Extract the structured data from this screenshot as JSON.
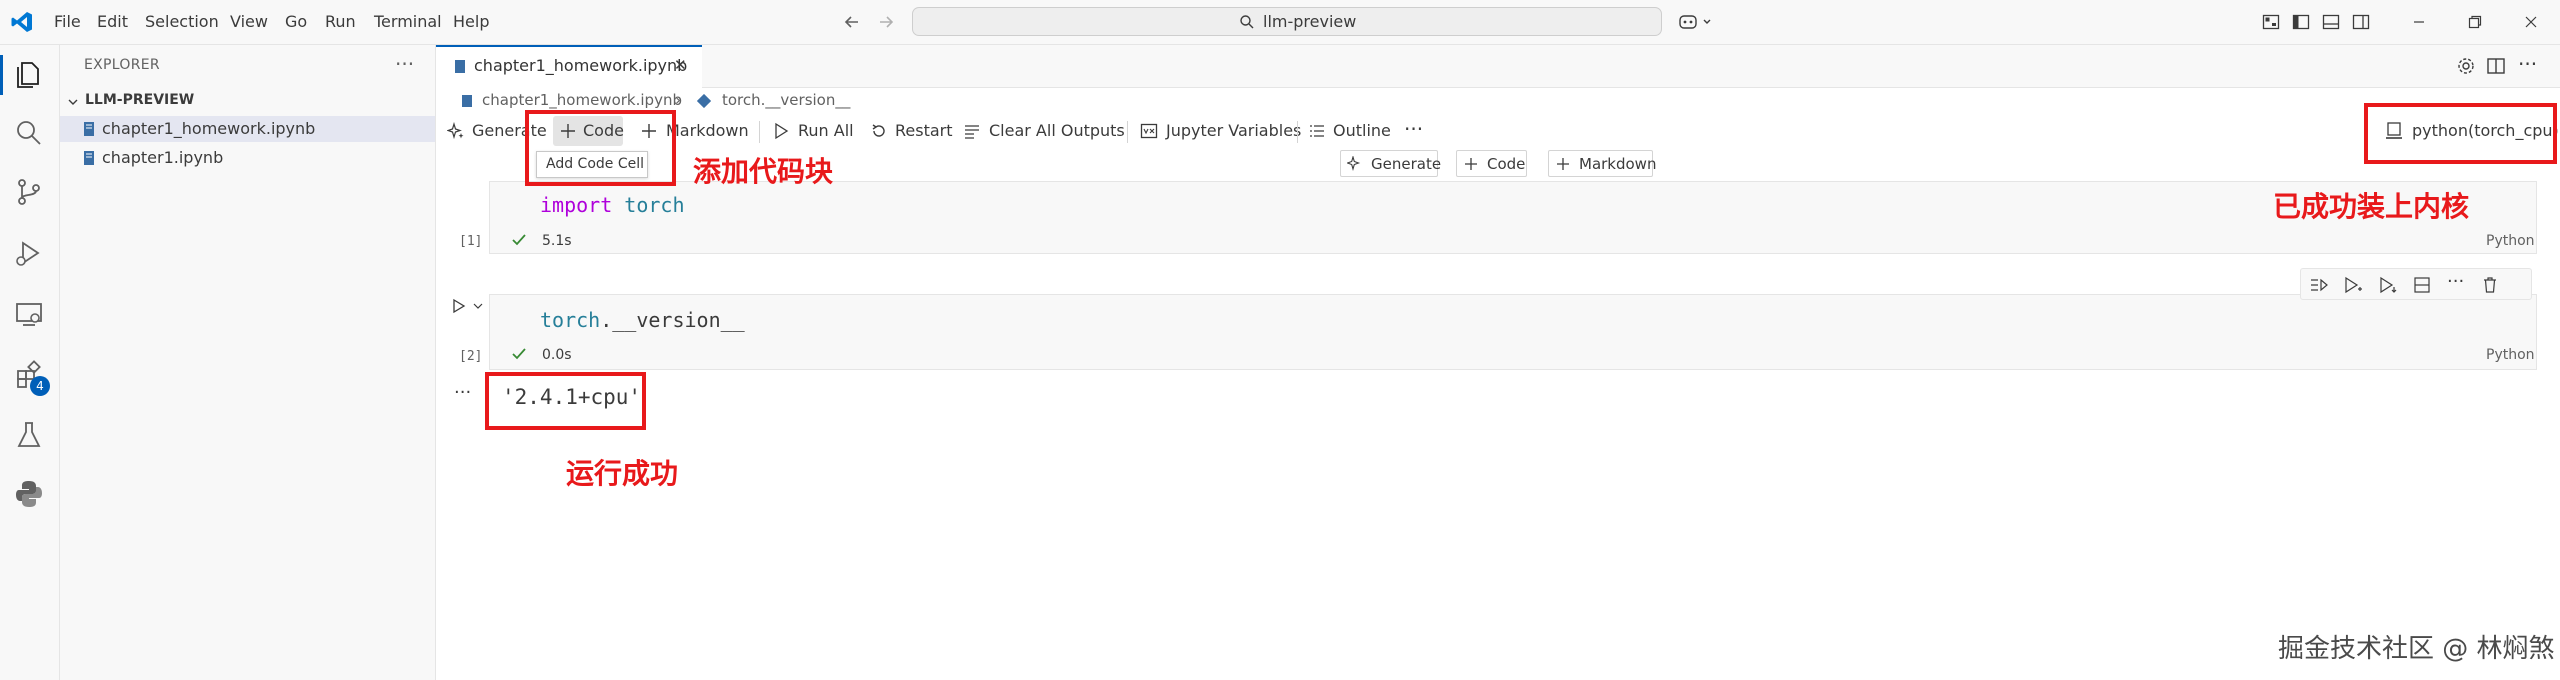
{
  "menu": [
    "File",
    "Edit",
    "Selection",
    "View",
    "Go",
    "Run",
    "Terminal",
    "Help"
  ],
  "search": {
    "text": "llm-preview"
  },
  "sidebar": {
    "title": "EXPLORER",
    "more": "···",
    "section": "LLM-PREVIEW",
    "files": [
      "chapter1_homework.ipynb",
      "chapter1.ipynb"
    ]
  },
  "activity": {
    "extensions_badge": "4"
  },
  "tab": {
    "label": "chapter1_homework.ipynb",
    "close": "✕"
  },
  "breadcrumb": {
    "file": "chapter1_homework.ipynb",
    "symbol": "torch.__version__"
  },
  "toolbar": {
    "generate": "Generate",
    "code": "Code",
    "markdown": "Markdown",
    "run_all": "Run All",
    "restart": "Restart",
    "clear_outputs": "Clear All Outputs",
    "jupyter_variables": "Jupyter Variables",
    "outline": "Outline",
    "more": "···"
  },
  "tooltip": "Add Code Cell",
  "between_cells": {
    "generate": "Generate",
    "code": "Code",
    "markdown": "Markdown"
  },
  "kernel": "python(torch_cpu)",
  "cells": [
    {
      "count": "[1]",
      "code_kw": "import",
      "code_id": "torch",
      "time": "5.1s",
      "lang": "Python"
    },
    {
      "count": "[2]",
      "code_id": "torch",
      "code_rest": ".__version__",
      "time": "0.0s",
      "lang": "Python",
      "output": "'2.4.1+cpu'"
    }
  ],
  "output_more": "···",
  "annotations": {
    "add_code": "添加代码块",
    "kernel_ok": "已成功装上内核",
    "run_ok": "运行成功"
  },
  "watermark": "掘金技术社区 @ 林焖煞",
  "colors": {
    "accent": "#005fb8",
    "annotation_red": "#e8191b",
    "success_green": "#388a34"
  }
}
